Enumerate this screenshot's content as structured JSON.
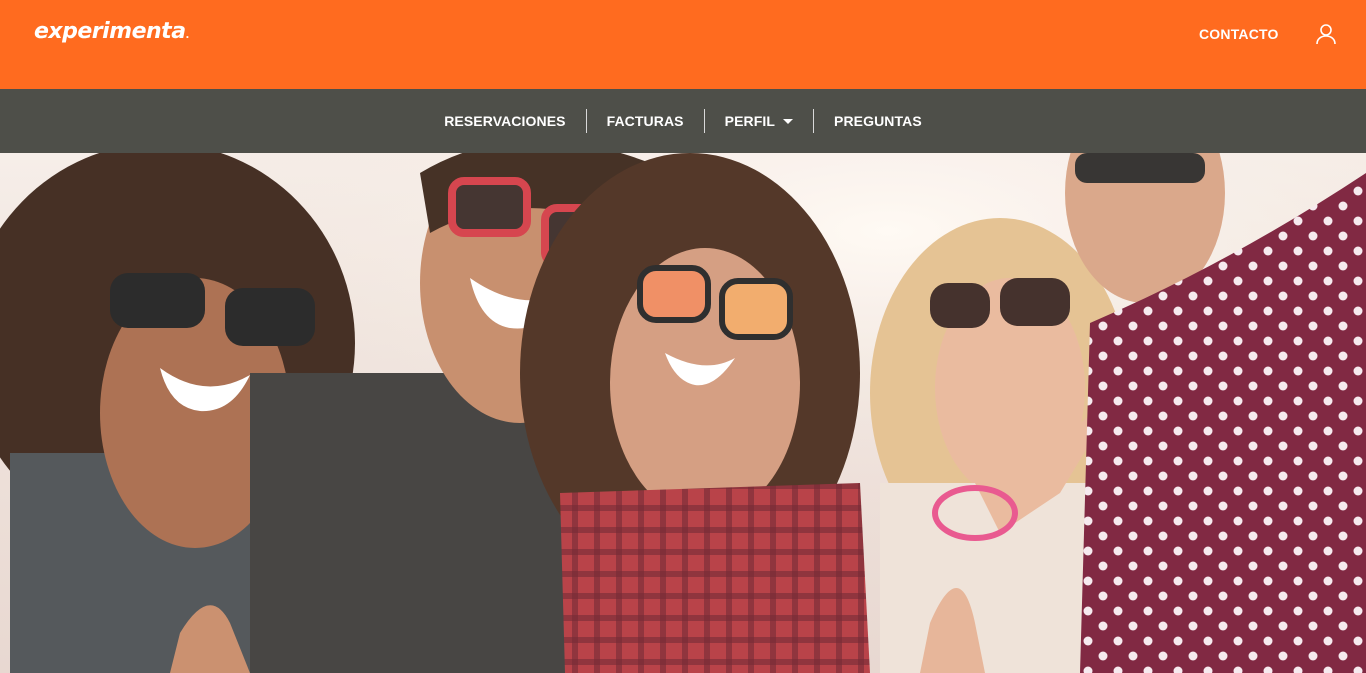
{
  "header": {
    "logo_text": "experimenta",
    "logo_mark": ".",
    "contact_label": "CONTACTO",
    "user_icon": "user-icon"
  },
  "nav": {
    "items": [
      {
        "label": "RESERVACIONES"
      },
      {
        "label": "FACTURAS"
      },
      {
        "label": "PERFIL",
        "has_dropdown": true
      },
      {
        "label": "PREGUNTAS"
      }
    ]
  },
  "hero": {
    "image_alt": "Group of smiling friends wearing sunglasses"
  },
  "colors": {
    "brand_orange": "#ff6b1f",
    "nav_gray": "#4e4f49",
    "text_white": "#ffffff"
  }
}
